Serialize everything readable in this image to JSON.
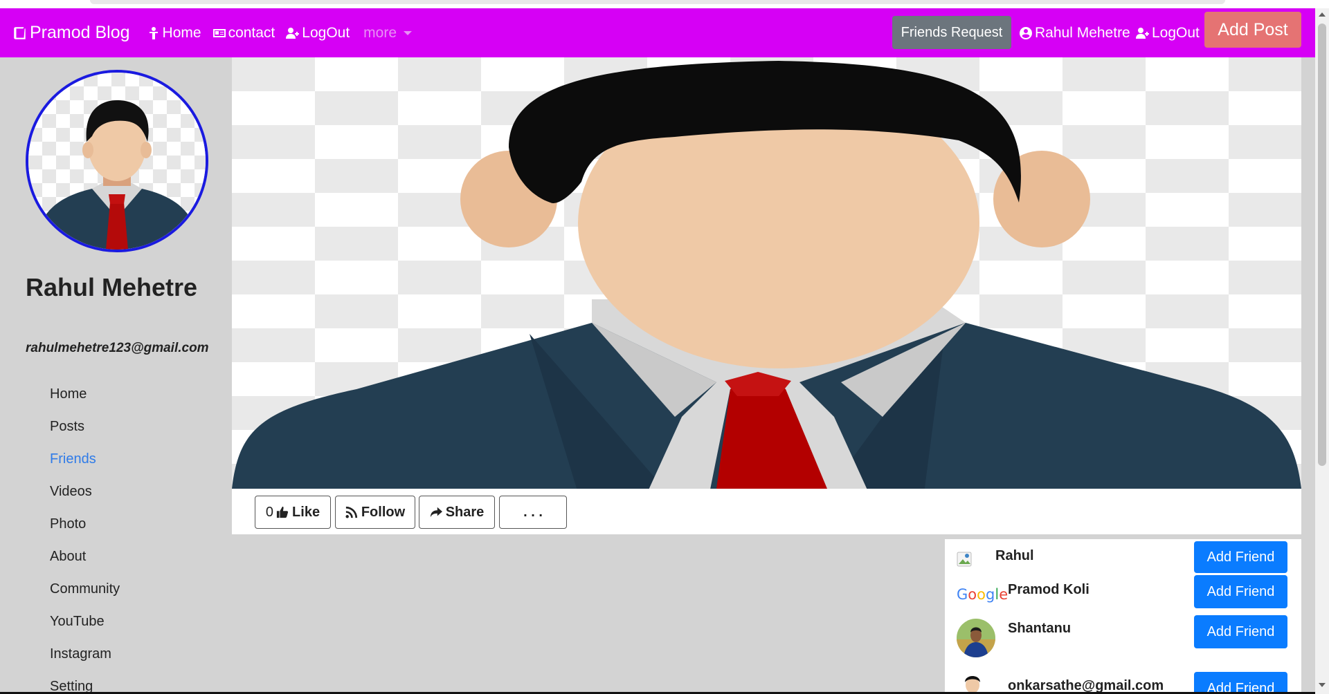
{
  "navbar": {
    "brand": "Pramod Blog",
    "home": "Home",
    "contact": "contact",
    "logout_left": "LogOut",
    "more": "more",
    "friends_request": "Friends Request",
    "user_name": "Rahul Mehetre",
    "logout_right": "LogOut",
    "add_post": "Add Post",
    "bg_color": "#d600f5"
  },
  "profile": {
    "name": "Rahul Mehetre",
    "email": "rahulmehetre123@gmail.com"
  },
  "sidebar": {
    "items": [
      {
        "label": "Home"
      },
      {
        "label": "Posts"
      },
      {
        "label": "Friends",
        "active": true
      },
      {
        "label": "Videos"
      },
      {
        "label": "Photo"
      },
      {
        "label": "About"
      },
      {
        "label": "Community"
      },
      {
        "label": "YouTube"
      },
      {
        "label": "Instagram"
      },
      {
        "label": "Setting"
      }
    ]
  },
  "actions": {
    "like_count": "0",
    "like_label": "Like",
    "follow_label": "Follow",
    "share_label": "Share",
    "more_label": ". . ."
  },
  "friends": [
    {
      "name": "Rahul",
      "button": "Add Friend"
    },
    {
      "name": "Pramod Koli",
      "button": "Add Friend",
      "logo_text": "Google"
    },
    {
      "name": "Shantanu",
      "button": "Add Friend"
    },
    {
      "name": "onkarsathe@gmail.com",
      "button": "Add Friend"
    }
  ]
}
